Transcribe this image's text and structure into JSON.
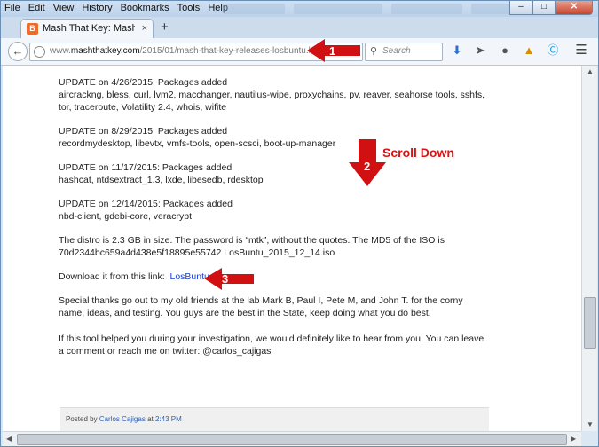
{
  "menu": [
    "File",
    "Edit",
    "View",
    "History",
    "Bookmarks",
    "Tools",
    "Help"
  ],
  "window_buttons": {
    "minimize": "–",
    "restore": "□",
    "close": "✕"
  },
  "tab": {
    "title": "Mash That Key: Mash That ...",
    "close": "×",
    "new_tab": "+"
  },
  "address": {
    "prefix": "www.",
    "domain": "mashthatkey.com",
    "path": "/2015/01/mash-that-key-releases-losbuntu.html"
  },
  "search": {
    "placeholder": "Search"
  },
  "toolbar_icons": [
    "download-icon",
    "send-icon",
    "chat-icon",
    "share-icon",
    "skype-icon",
    "menu-icon"
  ],
  "article": {
    "update1_title": "UPDATE on 4/26/2015:  Packages added",
    "update1_body": "aircrackng, bless, curl, lvm2, macchanger, nautilus-wipe, proxychains, pv, reaver, seahorse tools, sshfs, tor, traceroute, Volatility 2.4, whois, wifite",
    "update2_title": "UPDATE on 8/29/2015:  Packages added",
    "update2_body": "recordmydesktop, libevtx, vmfs-tools, open-scsci, boot-up-manager",
    "update3_title": "UPDATE on 11/17/2015:  Packages added",
    "update3_body": "hashcat, ntdsextract_1.3, lxde, libesedb, rdesktop",
    "update4_title": "UPDATE on 12/14/2015:  Packages added",
    "update4_body": "nbd-client, gdebi-core, veracrypt",
    "distro": "The distro is 2.3 GB in size. The password is “mtk”, without the quotes. The MD5 of the ISO is 70d2344bc659a4d438e5f18895e55742  LosBuntu_2015_12_14.iso",
    "download_label": "Download it from this link:",
    "download_link": "LosBuntu",
    "thanks": "Special thanks go out to my old friends at the lab Mark B, Paul I, Pete M, and John T. for the corny name, ideas, and testing. You guys are the best in the State, keep doing what you do best.",
    "feedback": "If this tool helped you during your investigation, we would definitely like to hear from you. You can leave a comment or reach me on twitter: @carlos_cajigas"
  },
  "footer": {
    "posted_by": "Posted by",
    "author": "Carlos Cajigas",
    "at": "at",
    "time": "2:43 PM"
  },
  "annotations": {
    "step1": "1",
    "step2": "2",
    "step3": "3",
    "scroll_label": "Scroll Down",
    "color": "#d11111"
  },
  "colors": {
    "link": "#1a3fd6",
    "chrome": "#dbe7f3"
  }
}
